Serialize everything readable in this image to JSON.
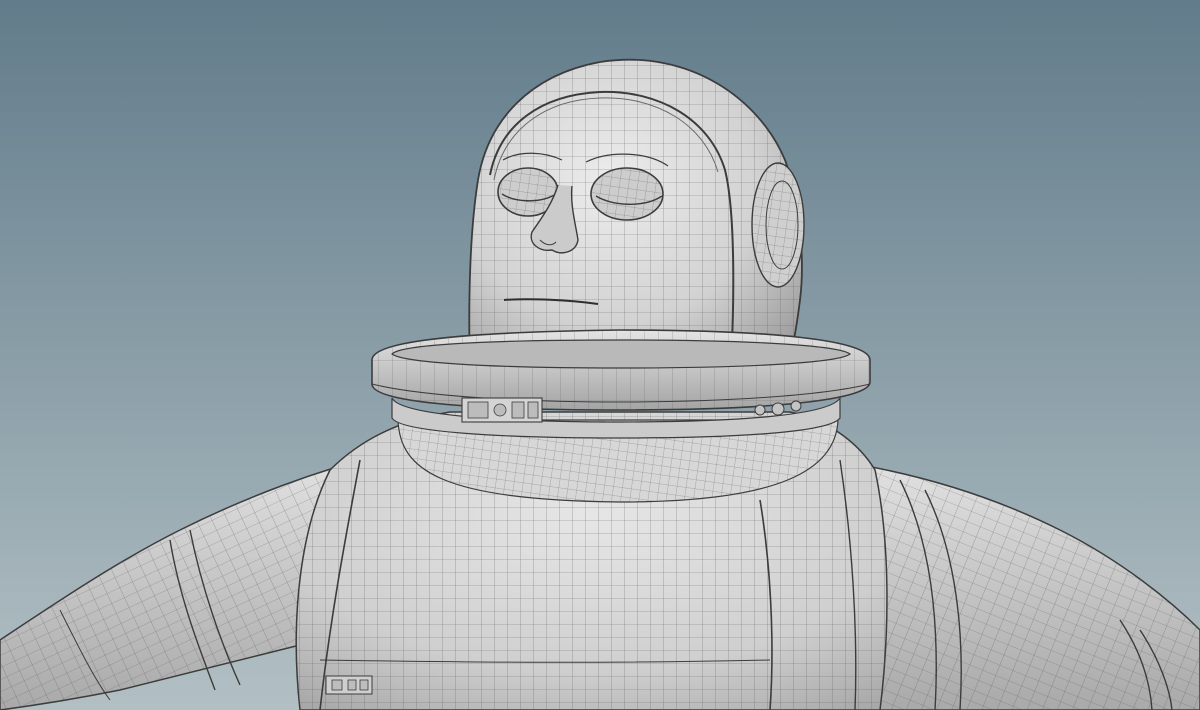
{
  "scene": {
    "subject": "astronaut-wireframe-model",
    "colors": {
      "sky_top": "#627c8b",
      "sky_bottom": "#b2c0c4",
      "surface": "#d2d2d2",
      "surface_shadow": "#9c9c9c",
      "surface_light": "#ececec",
      "wire": "#555555",
      "edge": "#3c3c3c"
    },
    "icons": [
      "collar-control-panel-icon",
      "collar-button-icon",
      "chest-panel-icon"
    ]
  }
}
